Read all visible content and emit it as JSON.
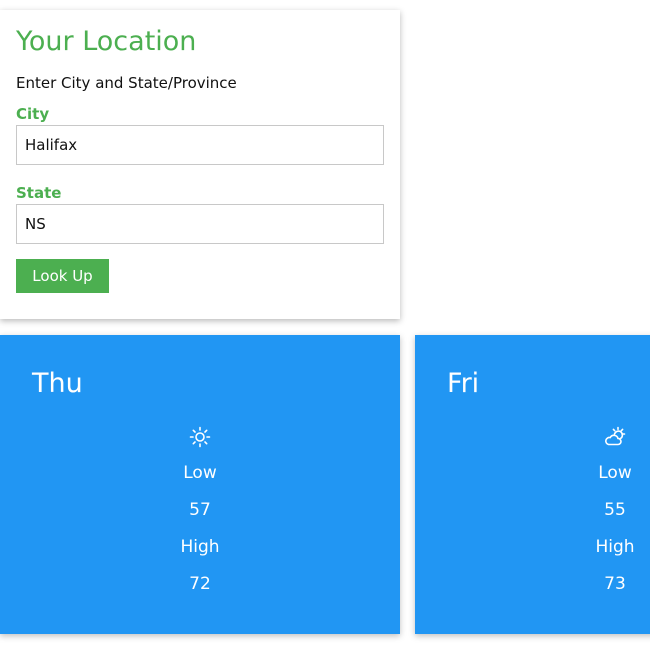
{
  "location": {
    "title": "Your Location",
    "subtitle": "Enter City and State/Province",
    "city_label": "City",
    "city_value": "Halifax",
    "state_label": "State",
    "state_value": "NS",
    "lookup_label": "Look Up"
  },
  "forecast": [
    {
      "day": "Thu",
      "icon": "sun-icon",
      "low_label": "Low",
      "low": "57",
      "high_label": "High",
      "high": "72"
    },
    {
      "day": "Fri",
      "icon": "partly-cloudy-icon",
      "low_label": "Low",
      "low": "55",
      "high_label": "High",
      "high": "73"
    }
  ],
  "colors": {
    "accent_green": "#4caf50",
    "forecast_blue": "#2196f3"
  }
}
